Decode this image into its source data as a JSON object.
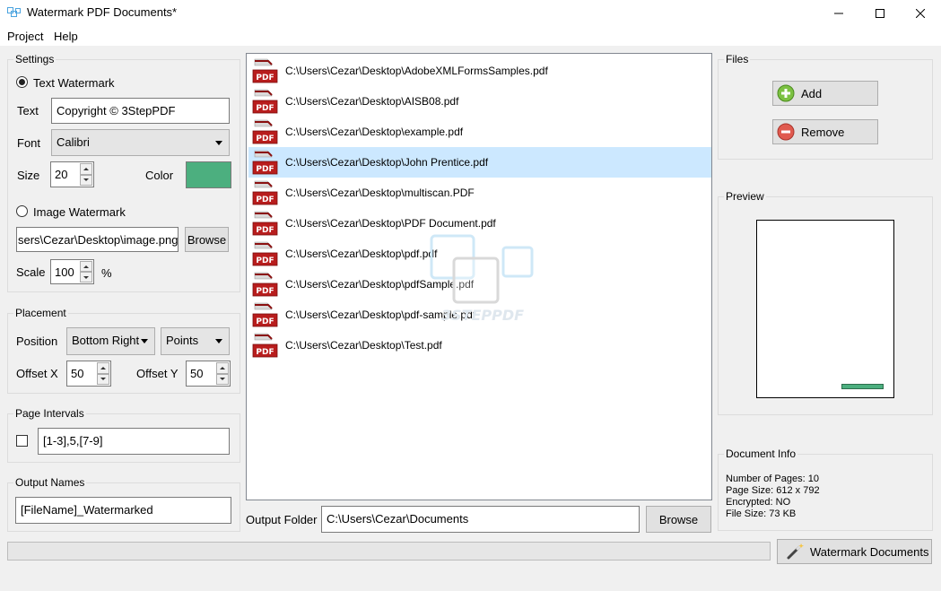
{
  "window": {
    "title": "Watermark PDF Documents*"
  },
  "menu": {
    "items": [
      "Project",
      "Help"
    ]
  },
  "settings": {
    "title": "Settings",
    "text_watermark": {
      "label": "Text Watermark",
      "selected": true
    },
    "text": {
      "label": "Text",
      "value": "Copyright © 3StepPDF"
    },
    "font": {
      "label": "Font",
      "value": "Calibri"
    },
    "size": {
      "label": "Size",
      "value": "20"
    },
    "color": {
      "label": "Color",
      "value": "#4caf7f"
    },
    "image_watermark": {
      "label": "Image Watermark",
      "selected": false
    },
    "image_path": "sers\\Cezar\\Desktop\\image.png",
    "browse_label": "Browse",
    "scale": {
      "label": "Scale",
      "value": "100",
      "unit": "%"
    }
  },
  "placement": {
    "title": "Placement",
    "position_label": "Position",
    "position_value": "Bottom Right",
    "units_value": "Points",
    "offset_x": {
      "label": "Offset X",
      "value": "50"
    },
    "offset_y": {
      "label": "Offset Y",
      "value": "50"
    }
  },
  "page_intervals": {
    "title": "Page Intervals",
    "checked": false,
    "value": "[1-3],5,[7-9]"
  },
  "output_names": {
    "title": "Output Names",
    "value": "[FileName]_Watermarked"
  },
  "files_list": [
    "C:\\Users\\Cezar\\Desktop\\AdobeXMLFormsSamples.pdf",
    "C:\\Users\\Cezar\\Desktop\\AISB08.pdf",
    "C:\\Users\\Cezar\\Desktop\\example.pdf",
    "C:\\Users\\Cezar\\Desktop\\John Prentice.pdf",
    "C:\\Users\\Cezar\\Desktop\\multiscan.PDF",
    "C:\\Users\\Cezar\\Desktop\\PDF Document.pdf",
    "C:\\Users\\Cezar\\Desktop\\pdf.pdf",
    "C:\\Users\\Cezar\\Desktop\\pdfSample.pdf",
    "C:\\Users\\Cezar\\Desktop\\pdf-sample.pdf",
    "C:\\Users\\Cezar\\Desktop\\Test.pdf"
  ],
  "selected_file_index": 3,
  "file_icon_label": "PDF",
  "watermark_logo_text": "3STEPPDF",
  "output_folder": {
    "label": "Output Folder",
    "value": "C:\\Users\\Cezar\\Documents",
    "browse_label": "Browse"
  },
  "files_panel": {
    "title": "Files",
    "add_label": "Add",
    "remove_label": "Remove"
  },
  "preview": {
    "title": "Preview"
  },
  "doc_info": {
    "title": "Document Info",
    "pages": "Number of Pages: 10",
    "size": "Page Size: 612 x 792",
    "encrypted": "Encrypted: NO",
    "file_size": "File Size: 73 KB"
  },
  "watermark_button_label": "Watermark Documents",
  "progress": 0
}
